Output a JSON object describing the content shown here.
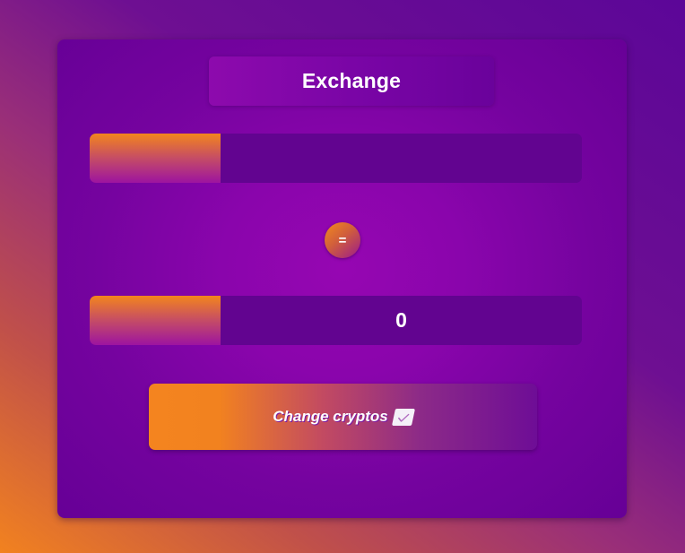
{
  "card": {
    "title": "Exchange"
  },
  "from": {
    "amount": ""
  },
  "to": {
    "amount": "0"
  },
  "equals": {
    "label": "="
  },
  "change_button": {
    "label": "Change cryptos",
    "icon": "check-mark-icon"
  },
  "colors": {
    "accent_orange": "#f2821f",
    "accent_purple": "#8a05ac",
    "field_background": "#620490",
    "text": "#ffffff"
  }
}
